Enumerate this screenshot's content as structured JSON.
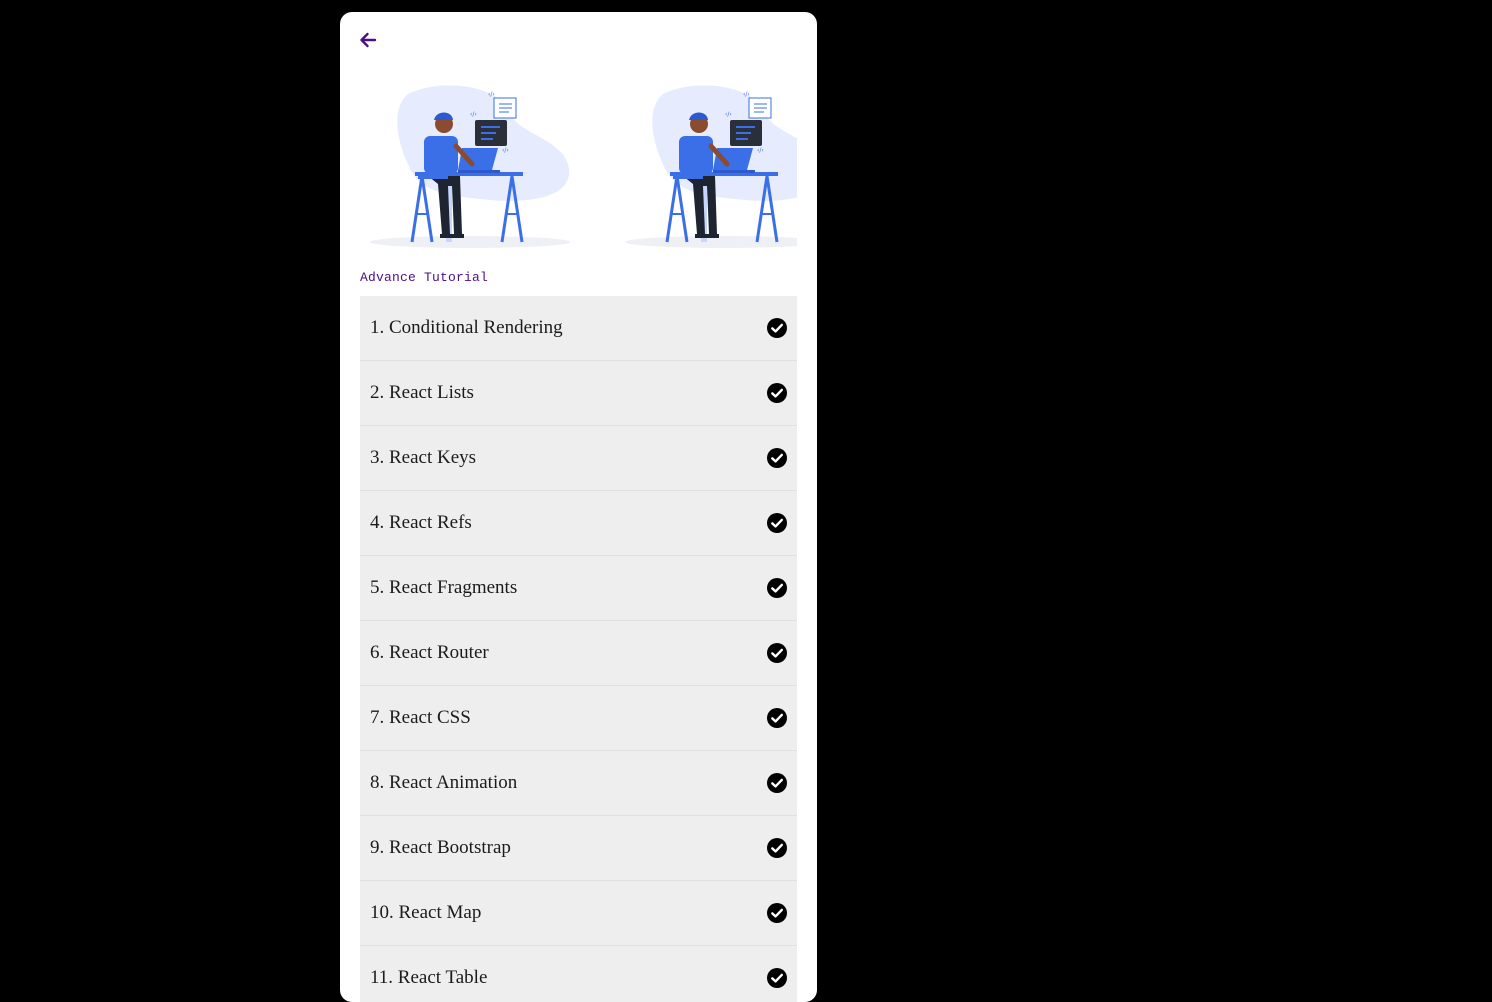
{
  "colors": {
    "page_background": "#000000",
    "card_background": "#ffffff",
    "accent": "#4b0f86",
    "lesson_background": "#eeeeee",
    "check_icon": "#000000",
    "illustration_blue": "#3b6fe8"
  },
  "header": {
    "back_icon": "arrow-left-icon"
  },
  "hero": {
    "illustration": "developer-at-laptop-illustration"
  },
  "section": {
    "title": "Advance Tutorial"
  },
  "lessons": [
    {
      "label": "1. Conditional Rendering",
      "status_icon": "check-circle-icon"
    },
    {
      "label": "2. React Lists",
      "status_icon": "check-circle-icon"
    },
    {
      "label": "3. React Keys",
      "status_icon": "check-circle-icon"
    },
    {
      "label": "4. React Refs",
      "status_icon": "check-circle-icon"
    },
    {
      "label": "5. React Fragments",
      "status_icon": "check-circle-icon"
    },
    {
      "label": "6. React Router",
      "status_icon": "check-circle-icon"
    },
    {
      "label": "7. React CSS",
      "status_icon": "check-circle-icon"
    },
    {
      "label": "8. React Animation",
      "status_icon": "check-circle-icon"
    },
    {
      "label": "9. React Bootstrap",
      "status_icon": "check-circle-icon"
    },
    {
      "label": "10. React Map",
      "status_icon": "check-circle-icon"
    },
    {
      "label": "11. React Table",
      "status_icon": "check-circle-icon"
    }
  ]
}
